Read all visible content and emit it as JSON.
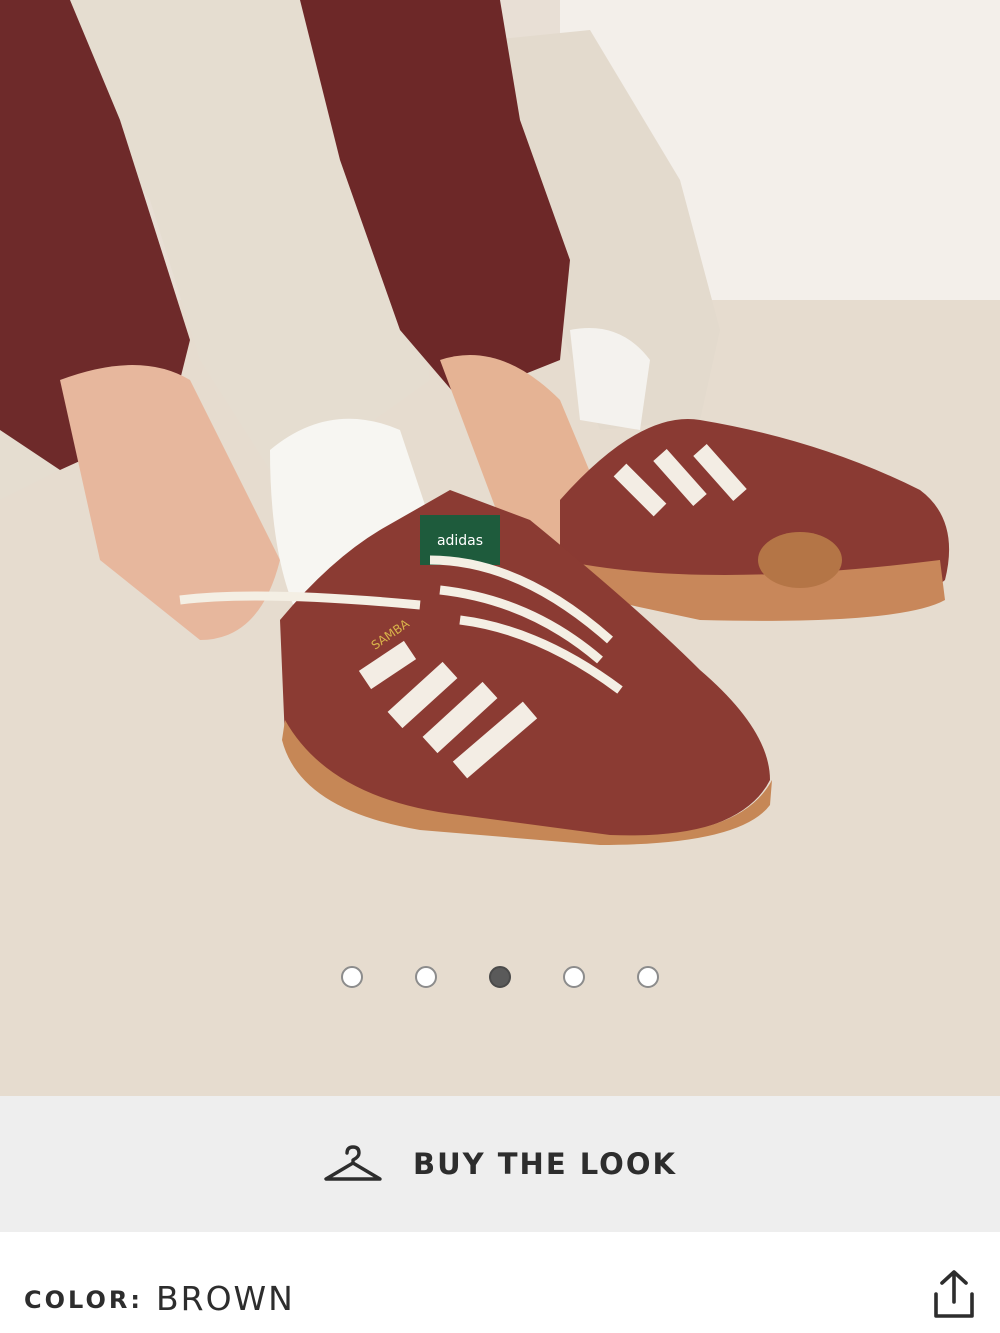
{
  "gallery": {
    "image_alt": "",
    "dots": [
      {
        "active": false
      },
      {
        "active": false
      },
      {
        "active": true
      },
      {
        "active": false
      },
      {
        "active": false
      }
    ],
    "shoe_brand_text": "adidas",
    "shoe_model_text": "SAMBA"
  },
  "buy_the_look": {
    "label": "BUY THE LOOK",
    "icon": "hanger-icon"
  },
  "product": {
    "color_label": "COLOR:",
    "color_value": "BROWN",
    "share_icon": "share-icon"
  },
  "colors": {
    "bar_background": "#eeeeee",
    "text": "#2d2d2d",
    "active_dot": "#5a5a5a"
  }
}
